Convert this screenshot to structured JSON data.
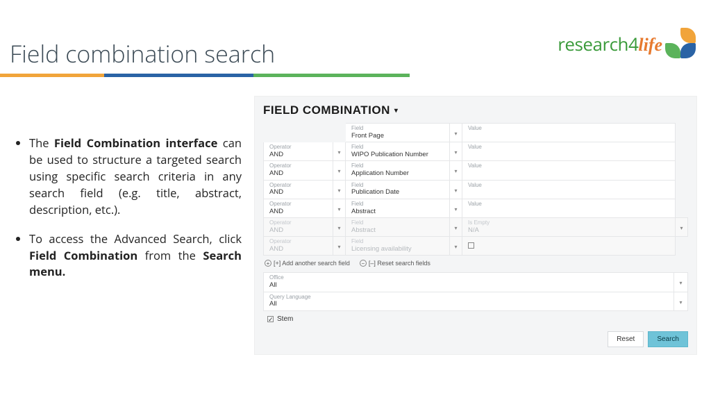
{
  "title": "Field combination search",
  "logo": {
    "text_r4": "research4",
    "text_life": "life"
  },
  "bullets": [
    {
      "pre": "The ",
      "b1": "Field Combination interface",
      "mid": " can be used to structure a targeted search using specific search criteria in any search field (e.g. title, abstract, description, etc.)."
    },
    {
      "pre": "To access the Advanced Search, click ",
      "b1": "Field Combination",
      "mid": " from the ",
      "b2": "Search menu."
    }
  ],
  "shot": {
    "title": "FIELD COMBINATION",
    "labels": {
      "operator": "Operator",
      "field": "Field",
      "value": "Value",
      "isempty": "Is Empty"
    },
    "rows": [
      {
        "op": null,
        "field": "Front Page",
        "value_label": "Value",
        "value": "",
        "dim": false
      },
      {
        "op": "AND",
        "field": "WIPO Publication Number",
        "value_label": "Value",
        "value": "",
        "dim": false
      },
      {
        "op": "AND",
        "field": "Application Number",
        "value_label": "Value",
        "value": "",
        "dim": false
      },
      {
        "op": "AND",
        "field": "Publication Date",
        "value_label": "Value",
        "value": "",
        "dim": false
      },
      {
        "op": "AND",
        "field": "Abstract",
        "value_label": "Value",
        "value": "",
        "dim": false
      },
      {
        "op": "AND",
        "field": "Abstract",
        "value_label": "Is Empty",
        "value": "N/A",
        "dim": true
      },
      {
        "op": "AND",
        "field": "Licensing availability",
        "value_label": "",
        "value": "",
        "dim": true,
        "checkbox": true
      }
    ],
    "add_label": "[+] Add another search field",
    "reset_fields_label": "[–] Reset search fields",
    "office": {
      "label": "Office",
      "value": "All"
    },
    "qlang": {
      "label": "Query Language",
      "value": "All"
    },
    "stem_label": "Stem",
    "reset_btn": "Reset",
    "search_btn": "Search"
  }
}
